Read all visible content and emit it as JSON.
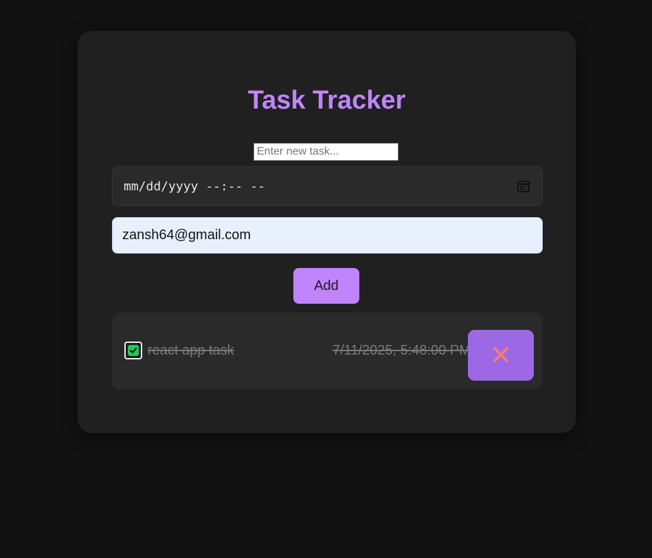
{
  "app": {
    "title": "Task Tracker"
  },
  "form": {
    "task_input": {
      "value": "",
      "placeholder": "Enter new task..."
    },
    "datetime": {
      "mask": "mm/dd/yyyy --:-- --",
      "icon": "calendar-icon"
    },
    "email": {
      "value": "zansh64@gmail.com"
    },
    "add_label": "Add"
  },
  "tasks": [
    {
      "text": "react app task",
      "datetime": "7/11/2025, 5:48:00 PM",
      "completed": true,
      "delete_icon": "close-icon"
    }
  ],
  "colors": {
    "page_bg": "#121212",
    "card_bg": "#202020",
    "accent": "#c084fc",
    "title": "#bf86fb",
    "checkbox_checked": "#22c55e",
    "delete_button": "#9c68e6",
    "delete_icon": "#f47a7a"
  }
}
